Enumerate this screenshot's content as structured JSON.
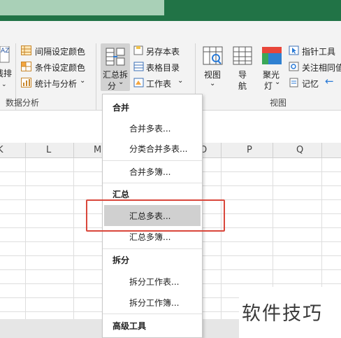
{
  "ribbon": {
    "data_analysis": {
      "partial_label_top": "AZ",
      "partial_label": "线排",
      "interval_color": "间隔设定颜色",
      "condition_color": "条件设定颜色",
      "stats_analysis": "统计与分析",
      "group_label": "数据分析"
    },
    "split_merge": {
      "label_line1": "汇总拆",
      "label_line2": "分",
      "save_as_table": "另存本表",
      "table_directory": "表格目录",
      "worksheet": "工作表"
    },
    "view": {
      "view_label": "视图",
      "nav_line1": "导",
      "nav_line2": "航",
      "spotlight_line1": "聚光",
      "spotlight_line2": "灯",
      "pointer_tool": "指针工具",
      "follow_same": "关注相同值",
      "memo": "记忆",
      "group_label": "视图"
    }
  },
  "sheet": {
    "columns": [
      "K",
      "L",
      "M",
      "N",
      "O",
      "P",
      "Q"
    ]
  },
  "menu": {
    "sections": [
      {
        "header": "合并",
        "items": [
          "合并多表...",
          "分类合并多表...",
          "合并多簿..."
        ]
      },
      {
        "header": "汇总",
        "items": [
          "汇总多表...",
          "汇总多簿..."
        ]
      },
      {
        "header": "拆分",
        "items": [
          "拆分工作表...",
          "拆分工作簿..."
        ]
      },
      {
        "header": "高级工具",
        "items": []
      }
    ],
    "highlighted": "汇总多表..."
  },
  "watermark": "软件技巧",
  "colors": {
    "title_bar": "#217346",
    "highlight_box": "#d9473b"
  }
}
